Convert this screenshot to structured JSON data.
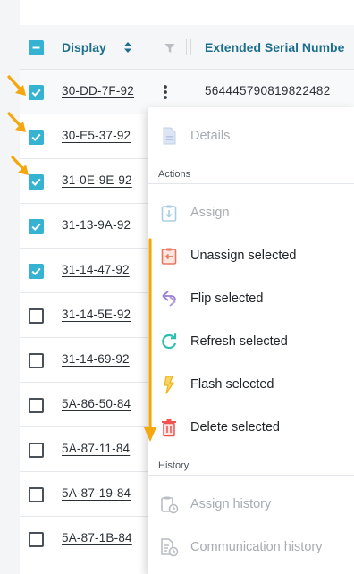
{
  "table": {
    "columns": {
      "display": "Display",
      "serial": "Extended Serial Numbe"
    },
    "rows": [
      {
        "display": "30-DD-7F-92",
        "serial": "564445790819822482",
        "checked": true
      },
      {
        "display": "30-E5-37-92",
        "serial": "",
        "checked": true
      },
      {
        "display": "31-0E-9E-92",
        "serial": "",
        "checked": true
      },
      {
        "display": "31-13-9A-92",
        "serial": "",
        "checked": true
      },
      {
        "display": "31-14-47-92",
        "serial": "",
        "checked": true
      },
      {
        "display": "31-14-5E-92",
        "serial": "",
        "checked": false
      },
      {
        "display": "31-14-69-92",
        "serial": "",
        "checked": false
      },
      {
        "display": "5A-86-50-84",
        "serial": "",
        "checked": false
      },
      {
        "display": "5A-87-11-84",
        "serial": "",
        "checked": false
      },
      {
        "display": "5A-87-19-84",
        "serial": "",
        "checked": false
      },
      {
        "display": "5A-87-1B-84",
        "serial": "",
        "checked": false
      }
    ]
  },
  "menu": {
    "details": "Details",
    "actions_header": "Actions",
    "assign": "Assign",
    "unassign_selected": "Unassign selected",
    "flip_selected": "Flip selected",
    "refresh_selected": "Refresh selected",
    "flash_selected": "Flash selected",
    "delete_selected": "Delete selected",
    "history_header": "History",
    "assign_history": "Assign history",
    "communication_history": "Communication history"
  },
  "icons": {
    "details": "document-icon",
    "assign": "clipboard-in-icon",
    "unassign": "clipboard-out-icon",
    "flip": "flip-arrows-icon",
    "refresh": "refresh-icon",
    "flash": "lightning-icon",
    "delete": "trash-icon",
    "assign_history": "clipboard-clock-icon",
    "communication_history": "document-clock-icon"
  },
  "colors": {
    "accent": "#35b3d1",
    "header_text": "#1e6f8c",
    "annotation": "#f5a70f",
    "unassign": "#e8765e",
    "flip": "#9b7fd6",
    "refresh": "#2bbfb0",
    "flash": "#f2b61b",
    "delete": "#ef5350",
    "disabled": "#a7acb2"
  }
}
